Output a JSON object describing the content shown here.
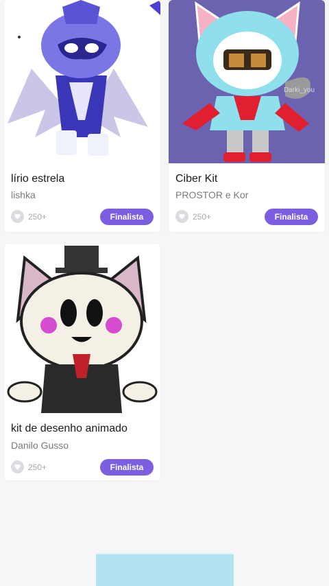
{
  "cards": [
    {
      "title": "lírio estrela",
      "author": "lishka",
      "likes": "250+",
      "badge": "Finalista",
      "image_desc_icon": "purple-knight-character-image"
    },
    {
      "title": "Ciber Kit",
      "author": "PROSTOR e Kor",
      "likes": "250+",
      "badge": "Finalista",
      "image_desc_icon": "cyber-cat-character-image",
      "watermark": "Darki_you"
    },
    {
      "title": "kit de desenho animado",
      "author": "Danilo Gusso",
      "likes": "250+",
      "badge": "Finalista",
      "image_desc_icon": "cartoon-cat-character-image"
    }
  ],
  "colors": {
    "badge": "#7b5fe0",
    "background": "#f6f6f8",
    "card": "#ffffff"
  }
}
